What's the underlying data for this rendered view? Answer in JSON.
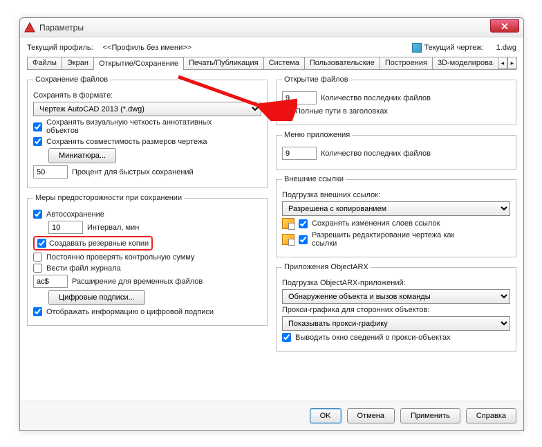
{
  "window": {
    "title": "Параметры"
  },
  "profile": {
    "label": "Текущий профиль:",
    "value": "<<Профиль без имени>>",
    "drawing_label": "Текущий чертеж:",
    "drawing_value": "1.dwg"
  },
  "tabs": {
    "items": [
      "Файлы",
      "Экран",
      "Открытие/Сохранение",
      "Печать/Публикация",
      "Система",
      "Пользовательские",
      "Построения",
      "3D-моделирова"
    ],
    "active_index": 2
  },
  "left": {
    "save_files": {
      "legend": "Сохранение файлов",
      "format_label": "Сохранять в формате:",
      "format_value": "Чертеж AutoCAD 2013 (*.dwg)",
      "cb_visual": "Сохранять визуальную четкость аннотативных объектов",
      "cb_size": "Сохранять совместимость размеров чертежа",
      "thumb_btn": "Миниатюра...",
      "percent_value": "50",
      "percent_label": "Процент для быстрых сохранений"
    },
    "precautions": {
      "legend": "Меры предосторожности при сохранении",
      "cb_auto": "Автосохранение",
      "interval_value": "10",
      "interval_label": "Интервал, мин",
      "cb_backup": "Создавать резервные копии",
      "cb_crc": "Постоянно проверять контрольную сумму",
      "cb_log": "Вести файл журнала",
      "ext_value": "ac$",
      "ext_label": "Расширение для временных файлов",
      "sig_btn": "Цифровые подписи...",
      "cb_siginfo": "Отображать информацию о цифровой подписи"
    }
  },
  "right": {
    "open_files": {
      "legend": "Открытие файлов",
      "recent_value": "9",
      "recent_label": "Количество последних файлов",
      "cb_fullpath": "Полные пути в заголовках"
    },
    "app_menu": {
      "legend": "Меню приложения",
      "recent_value": "9",
      "recent_label": "Количество последних файлов"
    },
    "xrefs": {
      "legend": "Внешние ссылки",
      "load_label": "Подгрузка внешних ссылок:",
      "load_value": "Разрешена с копированием",
      "cb_layers": "Сохранять изменения слоев ссылок",
      "cb_edit": "Разрешить редактирование чертежа как ссылки"
    },
    "arx": {
      "legend": "Приложения ObjectARX",
      "load_label": "Подгрузка ObjectARX-приложений:",
      "load_value": "Обнаружение объекта и вызов команды",
      "proxy_label": "Прокси-графика для сторонних объектов:",
      "proxy_value": "Показывать прокси-графику",
      "cb_proxyinfo": "Выводить окно сведений о прокси-объектах"
    }
  },
  "footer": {
    "ok": "OK",
    "cancel": "Отмена",
    "apply": "Применить",
    "help": "Справка"
  }
}
